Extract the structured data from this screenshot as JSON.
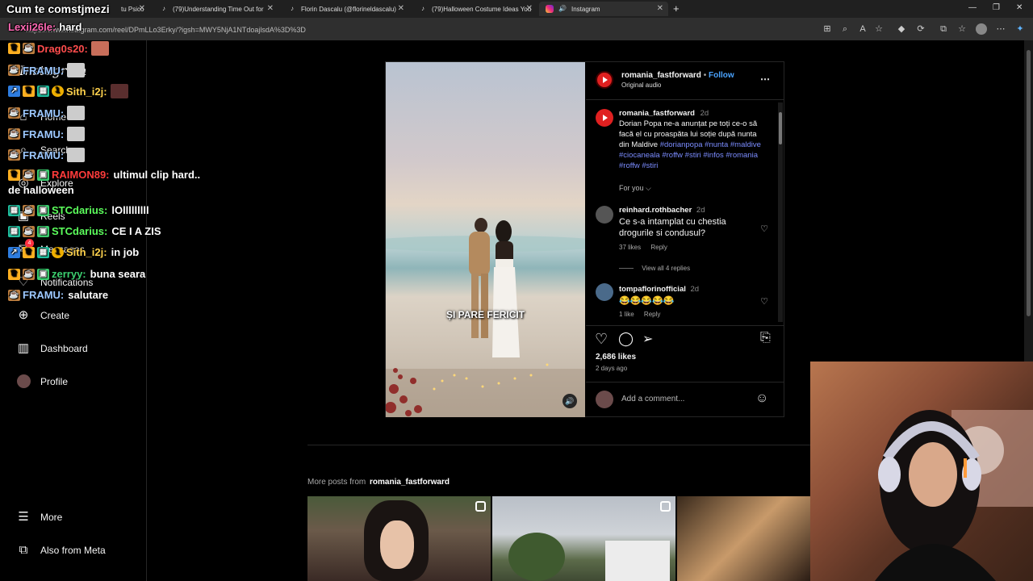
{
  "browser": {
    "tabs": [
      {
        "label": "Cum te comstjmezi",
        "icon": "tiktok-icon"
      },
      {
        "label": "tu Psico",
        "icon": "tiktok-icon"
      },
      {
        "label": "(79)Understanding Time Out for",
        "icon": "tiktok-icon"
      },
      {
        "label": "Florin Dascalu (@florineldascalu)",
        "icon": "tiktok-icon"
      },
      {
        "label": "(79)Halloween Costume Ideas You",
        "icon": "tiktok-icon"
      },
      {
        "label": "Instagram",
        "icon": "instagram-icon"
      }
    ],
    "url": "https://www.instagram.com/reel/DPmLLo3Erky/?igsh=MWY5NjA1NTdoajlsdA%3D%3D"
  },
  "sidebar": {
    "logo": "Instagram",
    "items": [
      {
        "label": "Home",
        "icon": "home-icon"
      },
      {
        "label": "Search",
        "icon": "search-icon"
      },
      {
        "label": "Explore",
        "icon": "compass-icon"
      },
      {
        "label": "Reels",
        "icon": "reels-icon"
      },
      {
        "label": "Messages",
        "icon": "messenger-icon",
        "badge": "4"
      },
      {
        "label": "Notifications",
        "icon": "heart-icon"
      },
      {
        "label": "Create",
        "icon": "plus-icon"
      },
      {
        "label": "Dashboard",
        "icon": "chart-icon"
      },
      {
        "label": "Profile",
        "icon": "avatar-icon"
      },
      {
        "label": "More",
        "icon": "menu-icon"
      },
      {
        "label": "Also from Meta",
        "icon": "meta-icon"
      }
    ]
  },
  "chat": [
    {
      "user": "Cum te comstjmezi",
      "message": "",
      "color": "#ffffff"
    },
    {
      "user": "Lexii26le:",
      "message": "hard",
      "color": "#ff69b4"
    },
    {
      "user": "Drag0s20:",
      "message": "",
      "color": "#ff4d4d"
    },
    {
      "user": "FRAMU:",
      "message": "",
      "color": "#9cc8ff"
    },
    {
      "user": "Sith_i2j:",
      "message": "",
      "color": "#ffd24d"
    },
    {
      "user": "FRAMU:",
      "message": "",
      "color": "#9cc8ff"
    },
    {
      "user": "FRAMU:",
      "message": "",
      "color": "#9cc8ff"
    },
    {
      "user": "FRAMU:",
      "message": "",
      "color": "#9cc8ff"
    },
    {
      "user": "RAIMON89:",
      "message": "ultimul clip hard..",
      "color": "#ff3b3b"
    },
    {
      "user": "",
      "message": "de halloween",
      "color": "#ffffff"
    },
    {
      "user": "STCdarius:",
      "message": "lOlllllllll",
      "color": "#5cff5c"
    },
    {
      "user": "STCdarius:",
      "message": "CE I A ZIS",
      "color": "#5cff5c"
    },
    {
      "user": "Sith_i2j:",
      "message": "in job",
      "color": "#ffd24d"
    },
    {
      "user": "zerryy:",
      "message": "buna seara",
      "color": "#3cd070"
    },
    {
      "user": "FRAMU:",
      "message": "salutare",
      "color": "#9cc8ff"
    }
  ],
  "post": {
    "author": "romania_fastforward",
    "follow": "Follow",
    "audio": "Original audio",
    "caption_author": "romania_fastforward",
    "caption_time": "2d",
    "caption_text": "Dorian Popa ne-a anunțat pe toți ce-o să facă el cu proaspăta lui soție după nunta din Maldive",
    "hashtags_line1": "#dorianpopa #nunta",
    "hashtags_line2": "#maldive #ciocaneala #roffw #stiri",
    "hashtags_line3": "#infos #romania #roffw #stiri",
    "for_you": "For you",
    "video_caption": "ȘI PARE FERICIT",
    "comments": [
      {
        "user": "reinhard.rothbacher",
        "time": "2d",
        "text": "Ce s-a intamplat cu chestia drogurile si condusul?",
        "likes": "37 likes",
        "reply": "Reply",
        "view_replies": "View all 4 replies"
      },
      {
        "user": "tompaflorinofficial",
        "time": "2d",
        "text": "😂😂😂😂😂",
        "likes": "1 like",
        "reply": "Reply"
      }
    ],
    "likes": "2,686 likes",
    "posted": "2 days ago",
    "add_comment": "Add a comment..."
  },
  "more_posts": {
    "prefix": "More posts from",
    "author": "romania_fastforward"
  }
}
